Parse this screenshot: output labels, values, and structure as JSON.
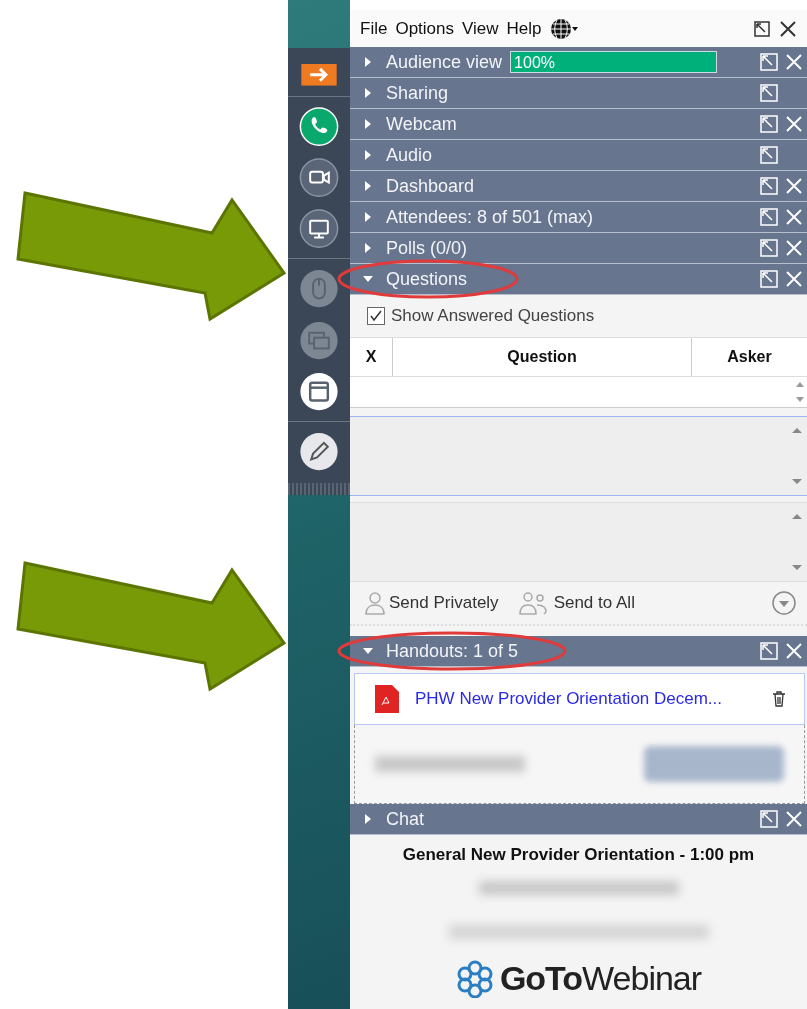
{
  "menu": [
    {
      "label": "File"
    },
    {
      "label": "Options"
    },
    {
      "label": "View"
    },
    {
      "label": "Help"
    }
  ],
  "panels": [
    {
      "kind": "audience",
      "title": "Audience view",
      "expanded": false,
      "closable": true,
      "circled": false,
      "meter": {
        "level": 1,
        "reading": "100%"
      }
    },
    {
      "kind": "plain",
      "title": "Sharing",
      "expanded": false,
      "closable": false,
      "circled": false
    },
    {
      "kind": "plain",
      "title": "Webcam",
      "expanded": false,
      "closable": true,
      "circled": false
    },
    {
      "kind": "plain",
      "title": "Audio",
      "expanded": false,
      "closable": false,
      "circled": false
    },
    {
      "kind": "plain",
      "title": "Dashboard",
      "expanded": false,
      "closable": true,
      "circled": false
    },
    {
      "kind": "plain",
      "title": "Attendees:  8 of 501 (max)",
      "expanded": false,
      "closable": true,
      "circled": false
    },
    {
      "kind": "plain",
      "title": "Polls (0/0)",
      "expanded": false,
      "closable": true,
      "circled": false
    },
    {
      "kind": "questions",
      "title": "Questions",
      "expanded": true,
      "closable": true,
      "circled": true,
      "show_answered": {
        "label": "Show Answered Questions",
        "checked": true
      },
      "columns": [
        "X",
        "Question",
        "Asker"
      ],
      "actions": [
        {
          "kind": "private",
          "label": "Send Privately"
        },
        {
          "kind": "all",
          "label": "Send to All"
        }
      ]
    },
    {
      "kind": "handouts",
      "title": "Handouts: 1 of 5",
      "expanded": true,
      "closable": true,
      "circled": true,
      "files": [
        {
          "name": "PHW New Provider Orientation Decem..."
        }
      ]
    },
    {
      "kind": "chat",
      "title": "Chat",
      "expanded": false,
      "closable": true,
      "circled": false,
      "webinar_title": "General New Provider Orientation - 1:00 pm",
      "brand": "**GoTo**Webinar"
    }
  ]
}
